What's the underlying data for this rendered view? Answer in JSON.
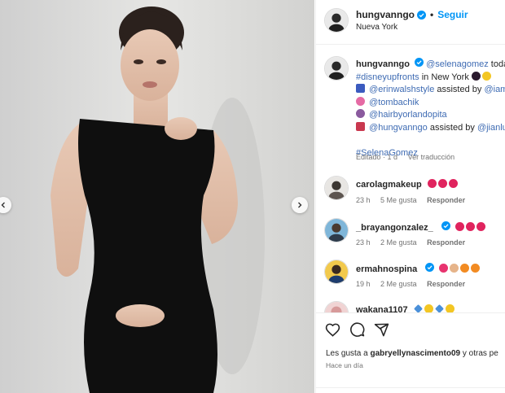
{
  "post_header": {
    "username": "hungvanngo",
    "separator": "•",
    "follow_label": "Seguir",
    "location": "Nueva York"
  },
  "caption": {
    "username": "hungvanngo",
    "mention_main": "@selenagomez",
    "after_main": " today for",
    "hashtag": "#disneyupfronts",
    "after_hashtag": " in New York",
    "styling": "@erinwalshstyle",
    "assisted_label": " assisted by ",
    "styling_assist": "@iamo",
    "nails": "@tombachik",
    "hair": "@hairbyorlandopita",
    "makeup": "@hungvanngo",
    "makeup_assist": "@jianlu",
    "tag_selena": "#SelenaGomez",
    "edited": "Editado · 1 d",
    "translate": "Ver traducción"
  },
  "comments": [
    {
      "username": "carolagmakeup",
      "time": "23 h",
      "likes": "5 Me gusta",
      "reply": "Responder"
    },
    {
      "username": "_brayangonzalez_",
      "time": "23 h",
      "likes": "2 Me gusta",
      "reply": "Responder"
    },
    {
      "username": "ermahnospina",
      "time": "19 h",
      "likes": "2 Me gusta",
      "reply": "Responder"
    },
    {
      "username": "wakana1107",
      "time": "",
      "likes": "",
      "reply": ""
    }
  ],
  "footer": {
    "likes_prefix": "Les gusta a ",
    "likes_user": "gabryellynascimento09",
    "likes_suffix": " y otras pe",
    "time": "Hace un día"
  },
  "colors": {
    "link": "#3e6bb3",
    "follow": "#0095f6",
    "verified": "#0095f6",
    "muted": "#737373"
  },
  "icons": [
    "chevron-left-icon",
    "chevron-right-icon",
    "verified-icon",
    "heart-icon",
    "comment-icon",
    "share-icon"
  ]
}
